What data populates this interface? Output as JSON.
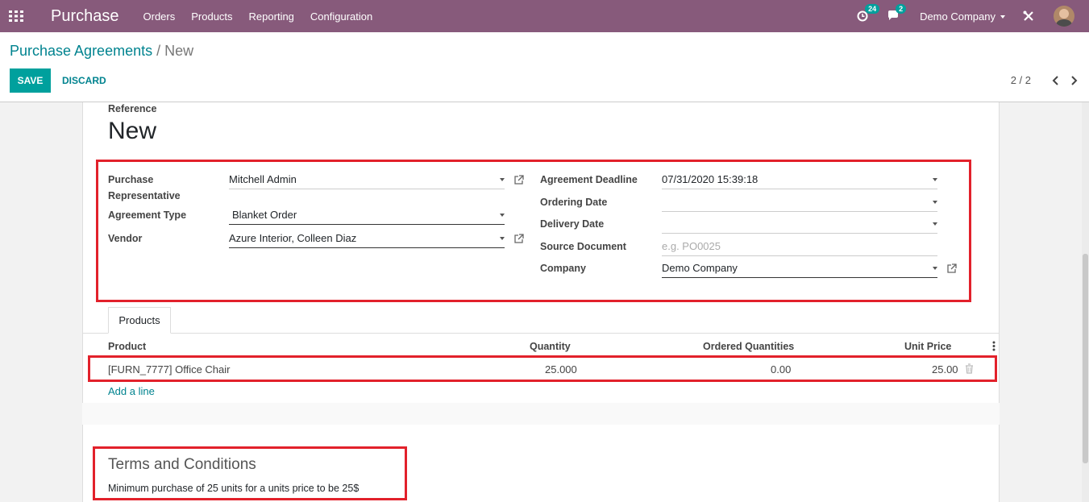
{
  "navbar": {
    "app_title": "Purchase",
    "menu": [
      "Orders",
      "Products",
      "Reporting",
      "Configuration"
    ],
    "activity_count": "24",
    "message_count": "2",
    "company": "Demo Company"
  },
  "control": {
    "breadcrumb_parent": "Purchase Agreements",
    "breadcrumb_sep": "/",
    "breadcrumb_current": "New",
    "save_label": "SAVE",
    "discard_label": "DISCARD",
    "pager": "2 / 2"
  },
  "form": {
    "reference_label": "Reference",
    "reference_value": "New",
    "rep_label_1": "Purchase",
    "rep_label_2": "Representative",
    "rep_value": "Mitchell Admin",
    "type_label": "Agreement Type",
    "type_value": "Blanket Order",
    "vendor_label": "Vendor",
    "vendor_value": "Azure Interior, Colleen Diaz",
    "deadline_label": "Agreement Deadline",
    "deadline_value": "07/31/2020 15:39:18",
    "ordering_label": "Ordering Date",
    "ordering_value": "",
    "delivery_label": "Delivery Date",
    "delivery_value": "",
    "source_label": "Source Document",
    "source_placeholder": "e.g. PO0025",
    "company_label": "Company",
    "company_value": "Demo Company"
  },
  "tabs": [
    "Products"
  ],
  "lines": {
    "columns": [
      "Product",
      "Quantity",
      "Ordered Quantities",
      "Unit Price"
    ],
    "rows": [
      {
        "product": "[FURN_7777] Office Chair",
        "quantity": "25.000",
        "ordered": "0.00",
        "price": "25.00"
      }
    ],
    "add_line": "Add a line"
  },
  "terms": {
    "title": "Terms and Conditions",
    "text": "Minimum purchase of 25 units for a units price to be 25$"
  },
  "colors": {
    "brand": "#875a7b",
    "primary": "#00a09d",
    "link": "#00838f",
    "highlight": "#e2212b"
  }
}
